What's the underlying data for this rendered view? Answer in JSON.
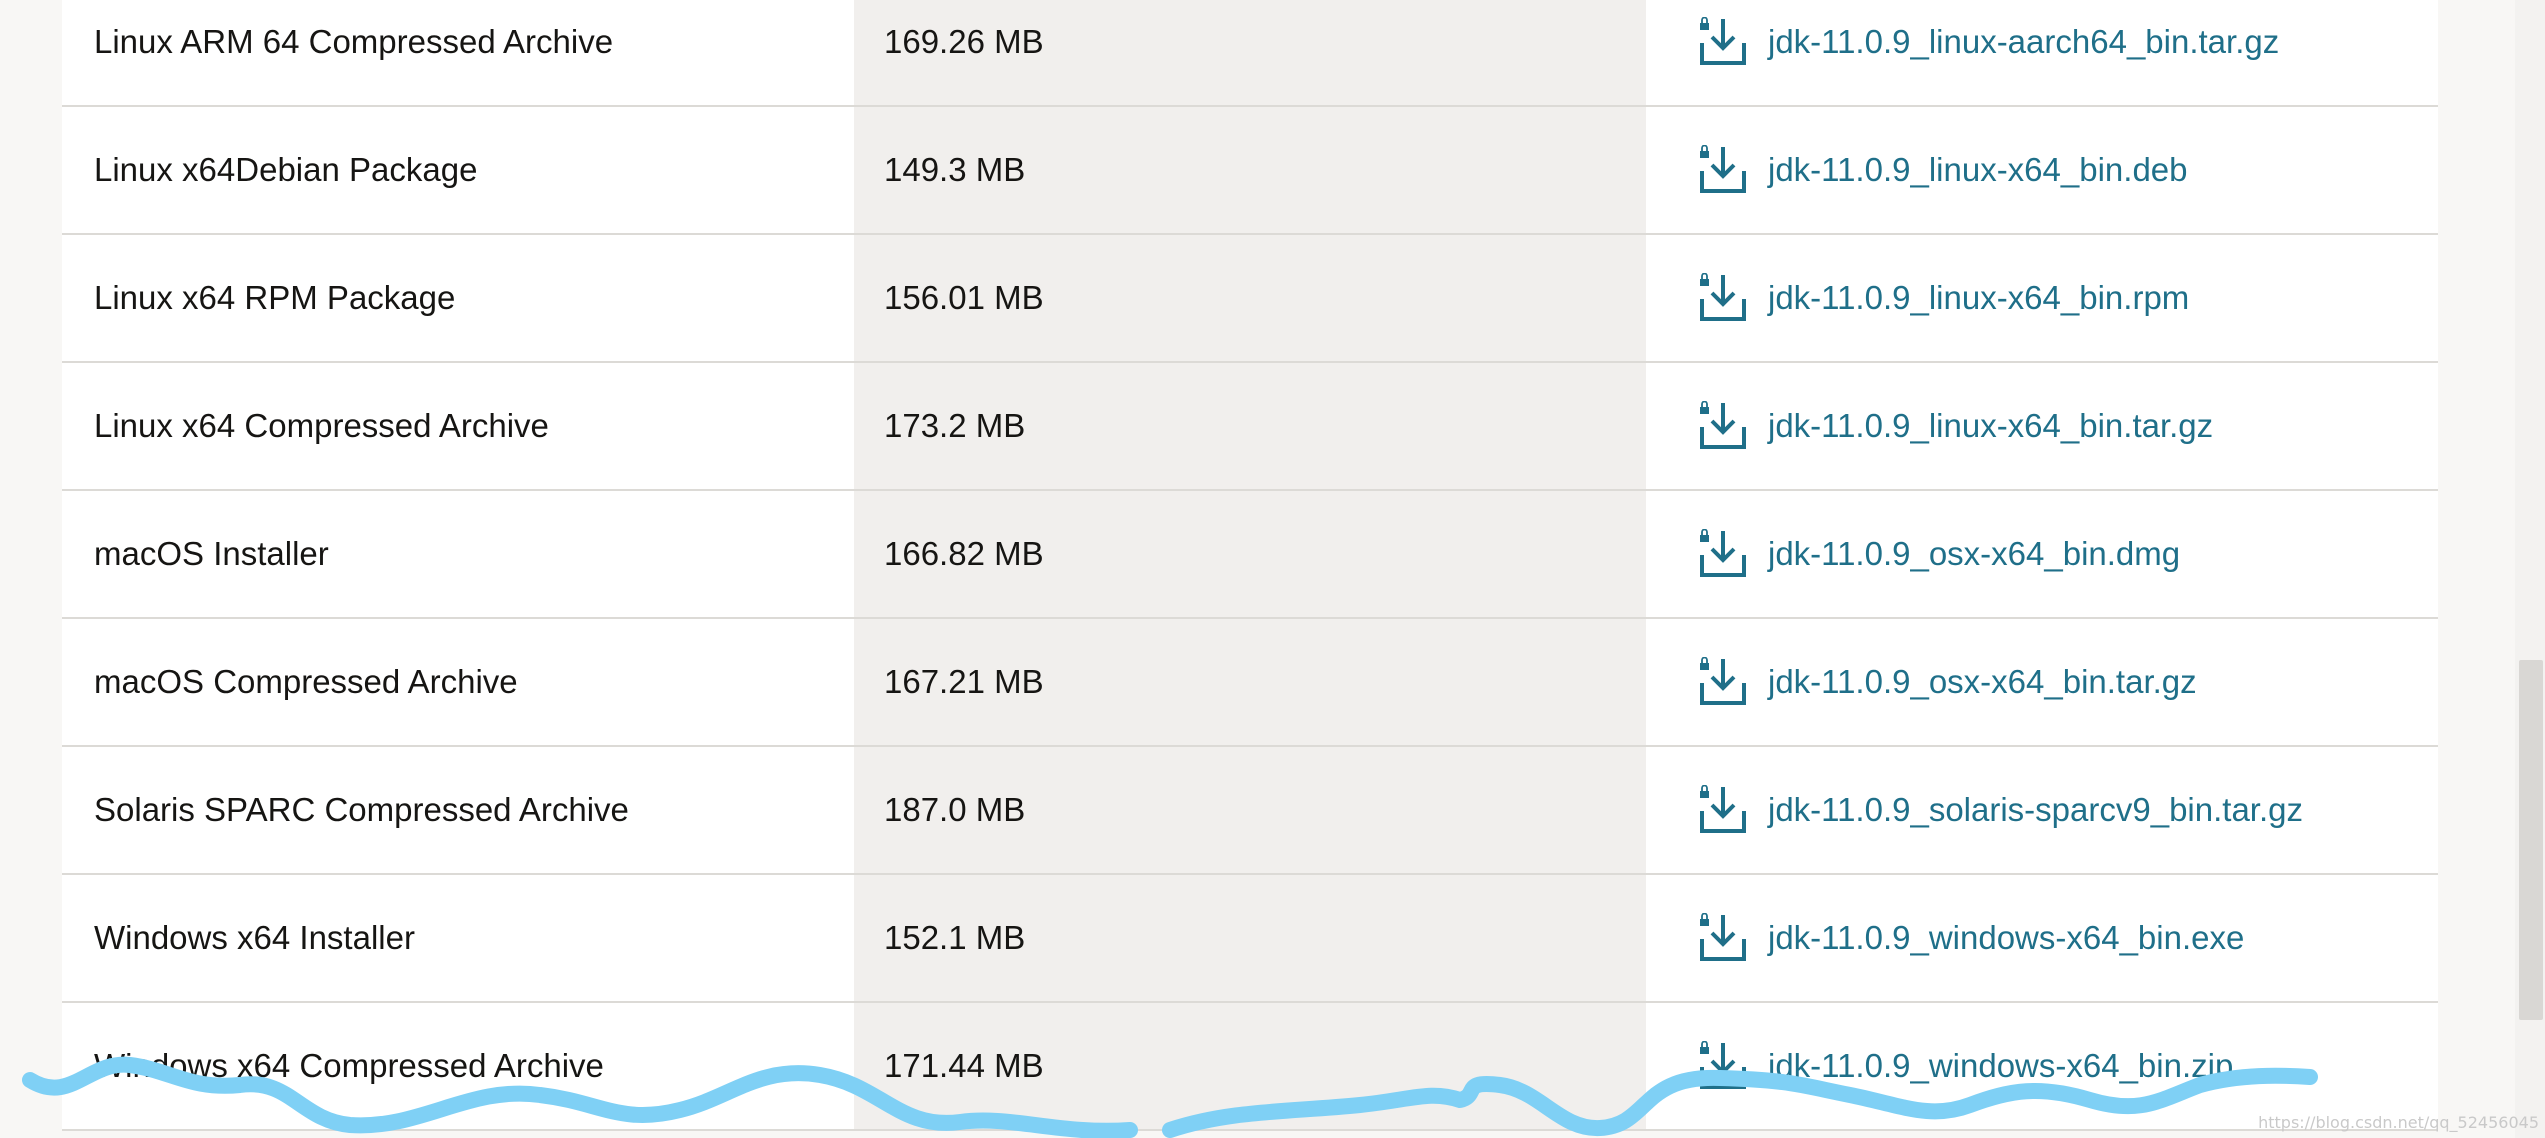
{
  "downloads": {
    "rows": [
      {
        "product": "Linux ARM 64 Compressed Archive",
        "size": "169.26 MB",
        "file": "jdk-11.0.9_linux-aarch64_bin.tar.gz"
      },
      {
        "product": "Linux x64Debian Package",
        "size": "149.3 MB",
        "file": "jdk-11.0.9_linux-x64_bin.deb"
      },
      {
        "product": "Linux x64 RPM Package",
        "size": "156.01 MB",
        "file": "jdk-11.0.9_linux-x64_bin.rpm"
      },
      {
        "product": "Linux x64 Compressed Archive",
        "size": "173.2 MB",
        "file": "jdk-11.0.9_linux-x64_bin.tar.gz"
      },
      {
        "product": "macOS Installer",
        "size": "166.82 MB",
        "file": "jdk-11.0.9_osx-x64_bin.dmg"
      },
      {
        "product": "macOS Compressed Archive",
        "size": "167.21 MB",
        "file": "jdk-11.0.9_osx-x64_bin.tar.gz"
      },
      {
        "product": "Solaris SPARC Compressed Archive",
        "size": "187.0 MB",
        "file": "jdk-11.0.9_solaris-sparcv9_bin.tar.gz"
      },
      {
        "product": "Windows x64 Installer",
        "size": "152.1 MB",
        "file": "jdk-11.0.9_windows-x64_bin.exe"
      },
      {
        "product": "Windows x64 Compressed Archive",
        "size": "171.44 MB",
        "file": "jdk-11.0.9_windows-x64_bin.zip"
      }
    ]
  },
  "icons": {
    "download": "download-lock-icon"
  },
  "colors": {
    "link": "#1f6f89",
    "size_column_bg": "#f1efed",
    "scribble": "#7fd0f5"
  },
  "watermark": "https://blog.csdn.net/qq_52456045"
}
